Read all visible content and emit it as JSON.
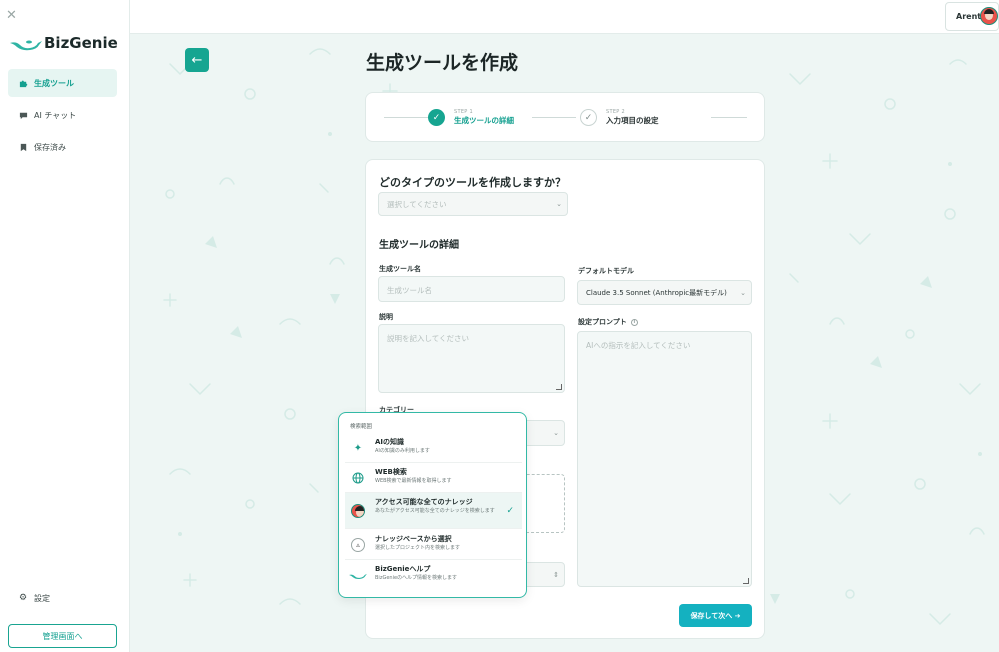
{
  "sidebar": {
    "brand": "BizGenie",
    "items": [
      {
        "label": "生成ツール",
        "icon": "puzzle-icon"
      },
      {
        "label": "AI チャット",
        "icon": "chat-bubble-icon"
      },
      {
        "label": "保存済み",
        "icon": "bookmark-icon"
      }
    ],
    "settings_label": "設定",
    "admin_button": "管理画面へ"
  },
  "header": {
    "user_name": "Arent"
  },
  "page": {
    "title": "生成ツールを作成"
  },
  "steps": [
    {
      "num": "STEP 1",
      "label": "生成ツールの詳細",
      "state": "done"
    },
    {
      "num": "STEP 2",
      "label": "入力項目の設定",
      "state": "todo"
    }
  ],
  "form": {
    "type_question": "どのタイプのツールを作成しますか？",
    "type_placeholder": "選択してください",
    "details_title": "生成ツールの詳細",
    "name_label": "生成ツール名",
    "name_placeholder": "生成ツール名",
    "desc_label": "説明",
    "desc_placeholder": "説明を記入してください",
    "category_label": "カテゴリー",
    "model_label": "デフォルトモデル",
    "model_value": "Claude 3.5 Sonnet (Anthropic最新モデル)",
    "prompt_label": "設定プロンプト",
    "prompt_placeholder": "AIへの指示を記入してください",
    "save_button": "保存して次へ"
  },
  "dropdown": {
    "header": "検索範囲",
    "options": [
      {
        "title": "AIの知識",
        "desc": "AIの知識のみ利用します",
        "icon": "sparkle-icon",
        "selected": false
      },
      {
        "title": "WEB検索",
        "desc": "WEB検索で最新情報を取得します",
        "icon": "globe-icon",
        "selected": false
      },
      {
        "title": "アクセス可能な全てのナレッジ",
        "desc": "あなたがアクセス可能な全てのナレッジを検索します",
        "icon": "avatar-icon",
        "selected": true
      },
      {
        "title": "ナレッジベースから選択",
        "desc": "選択したプロジェクト内を検索します",
        "icon": "knowledge-base-icon",
        "selected": false
      },
      {
        "title": "BizGenieヘルプ",
        "desc": "BizGenieのヘルプ情報を検索します",
        "icon": "genie-lamp-icon",
        "selected": false
      }
    ]
  },
  "colors": {
    "accent": "#16a591",
    "cta": "#14b1c0"
  }
}
